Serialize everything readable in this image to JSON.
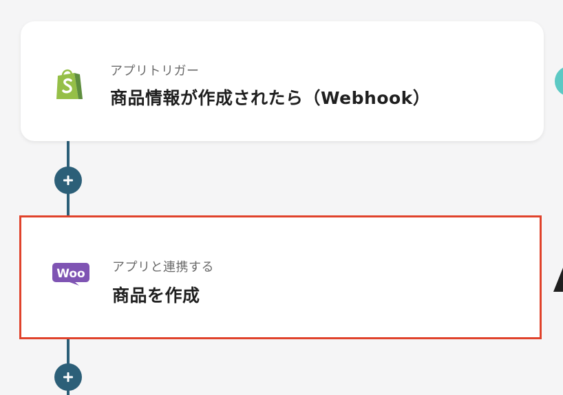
{
  "colors": {
    "background": "#f5f5f6",
    "connector": "#2c5f78",
    "highlight_border": "#e0422b",
    "shopify_green": "#95bf47",
    "woo_purple": "#7f54b3",
    "edge_teal": "#5cc9c4"
  },
  "steps": [
    {
      "icon": "shopify-icon",
      "label": "アプリトリガー",
      "title": "商品情報が作成されたら（Webhook）"
    },
    {
      "icon": "woocommerce-icon",
      "label": "アプリと連携する",
      "title": "商品を作成",
      "icon_text": "Woo"
    }
  ],
  "add_step_icon": "plus-icon"
}
